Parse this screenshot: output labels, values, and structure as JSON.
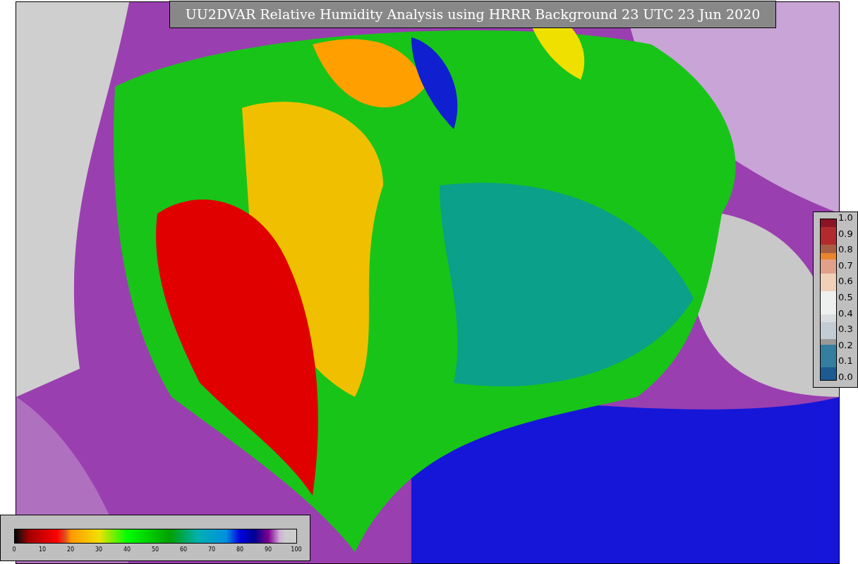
{
  "title": "UU2DVAR Relative Humidity Analysis using HRRR Background 23 UTC 23 Jun 2020",
  "right_colorbar": {
    "tick_labels": [
      "1.0",
      "0.9",
      "0.8",
      "0.7",
      "0.6",
      "0.5",
      "0.4",
      "0.3",
      "0.2",
      "0.1",
      "0.0"
    ]
  },
  "bottom_colorbar": {
    "tick_labels": [
      "0",
      "10",
      "20",
      "30",
      "40",
      "50",
      "60",
      "70",
      "80",
      "90",
      "100"
    ]
  }
}
